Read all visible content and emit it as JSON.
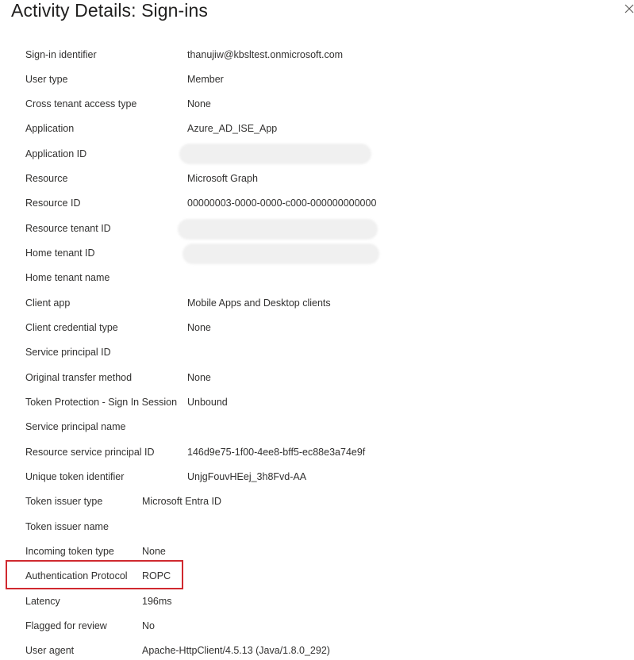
{
  "panel": {
    "title": "Activity Details: Sign-ins",
    "close_icon": "close-icon"
  },
  "details": [
    {
      "label": "Sign-in identifier",
      "value": "thanujiw@kbsltest.onmicrosoft.com"
    },
    {
      "label": "User type",
      "value": "Member"
    },
    {
      "label": "Cross tenant access type",
      "value": "None"
    },
    {
      "label": "Application",
      "value": "Azure_AD_ISE_App"
    },
    {
      "label": "Application ID",
      "value": ""
    },
    {
      "label": "Resource",
      "value": "Microsoft Graph"
    },
    {
      "label": "Resource ID",
      "value": "00000003-0000-0000-c000-000000000000"
    },
    {
      "label": "Resource tenant ID",
      "value": ""
    },
    {
      "label": "Home tenant ID",
      "value": ""
    },
    {
      "label": "Home tenant name",
      "value": ""
    },
    {
      "label": "Client app",
      "value": "Mobile Apps and Desktop clients"
    },
    {
      "label": "Client credential type",
      "value": "None"
    },
    {
      "label": "Service principal ID",
      "value": ""
    },
    {
      "label": "Original transfer method",
      "value": "None"
    },
    {
      "label": "Token Protection - Sign In Session",
      "value": "Unbound"
    },
    {
      "label": "Service principal name",
      "value": ""
    },
    {
      "label": "Resource service principal ID",
      "value": "146d9e75-1f00-4ee8-bff5-ec88e3a74e9f"
    },
    {
      "label": "Unique token identifier",
      "value": "UnjgFouvHEej_3h8Fvd-AA"
    },
    {
      "label": "Token issuer type",
      "value": "Microsoft Entra ID"
    },
    {
      "label": "Token issuer name",
      "value": ""
    },
    {
      "label": "Incoming token type",
      "value": "None"
    },
    {
      "label": "Authentication Protocol",
      "value": "ROPC"
    },
    {
      "label": "Latency",
      "value": "196ms"
    },
    {
      "label": "Flagged for review",
      "value": "No"
    },
    {
      "label": "User agent",
      "value": "Apache-HttpClient/4.5.13 (Java/1.8.0_292)"
    }
  ],
  "highlight_color": "#d0292f"
}
